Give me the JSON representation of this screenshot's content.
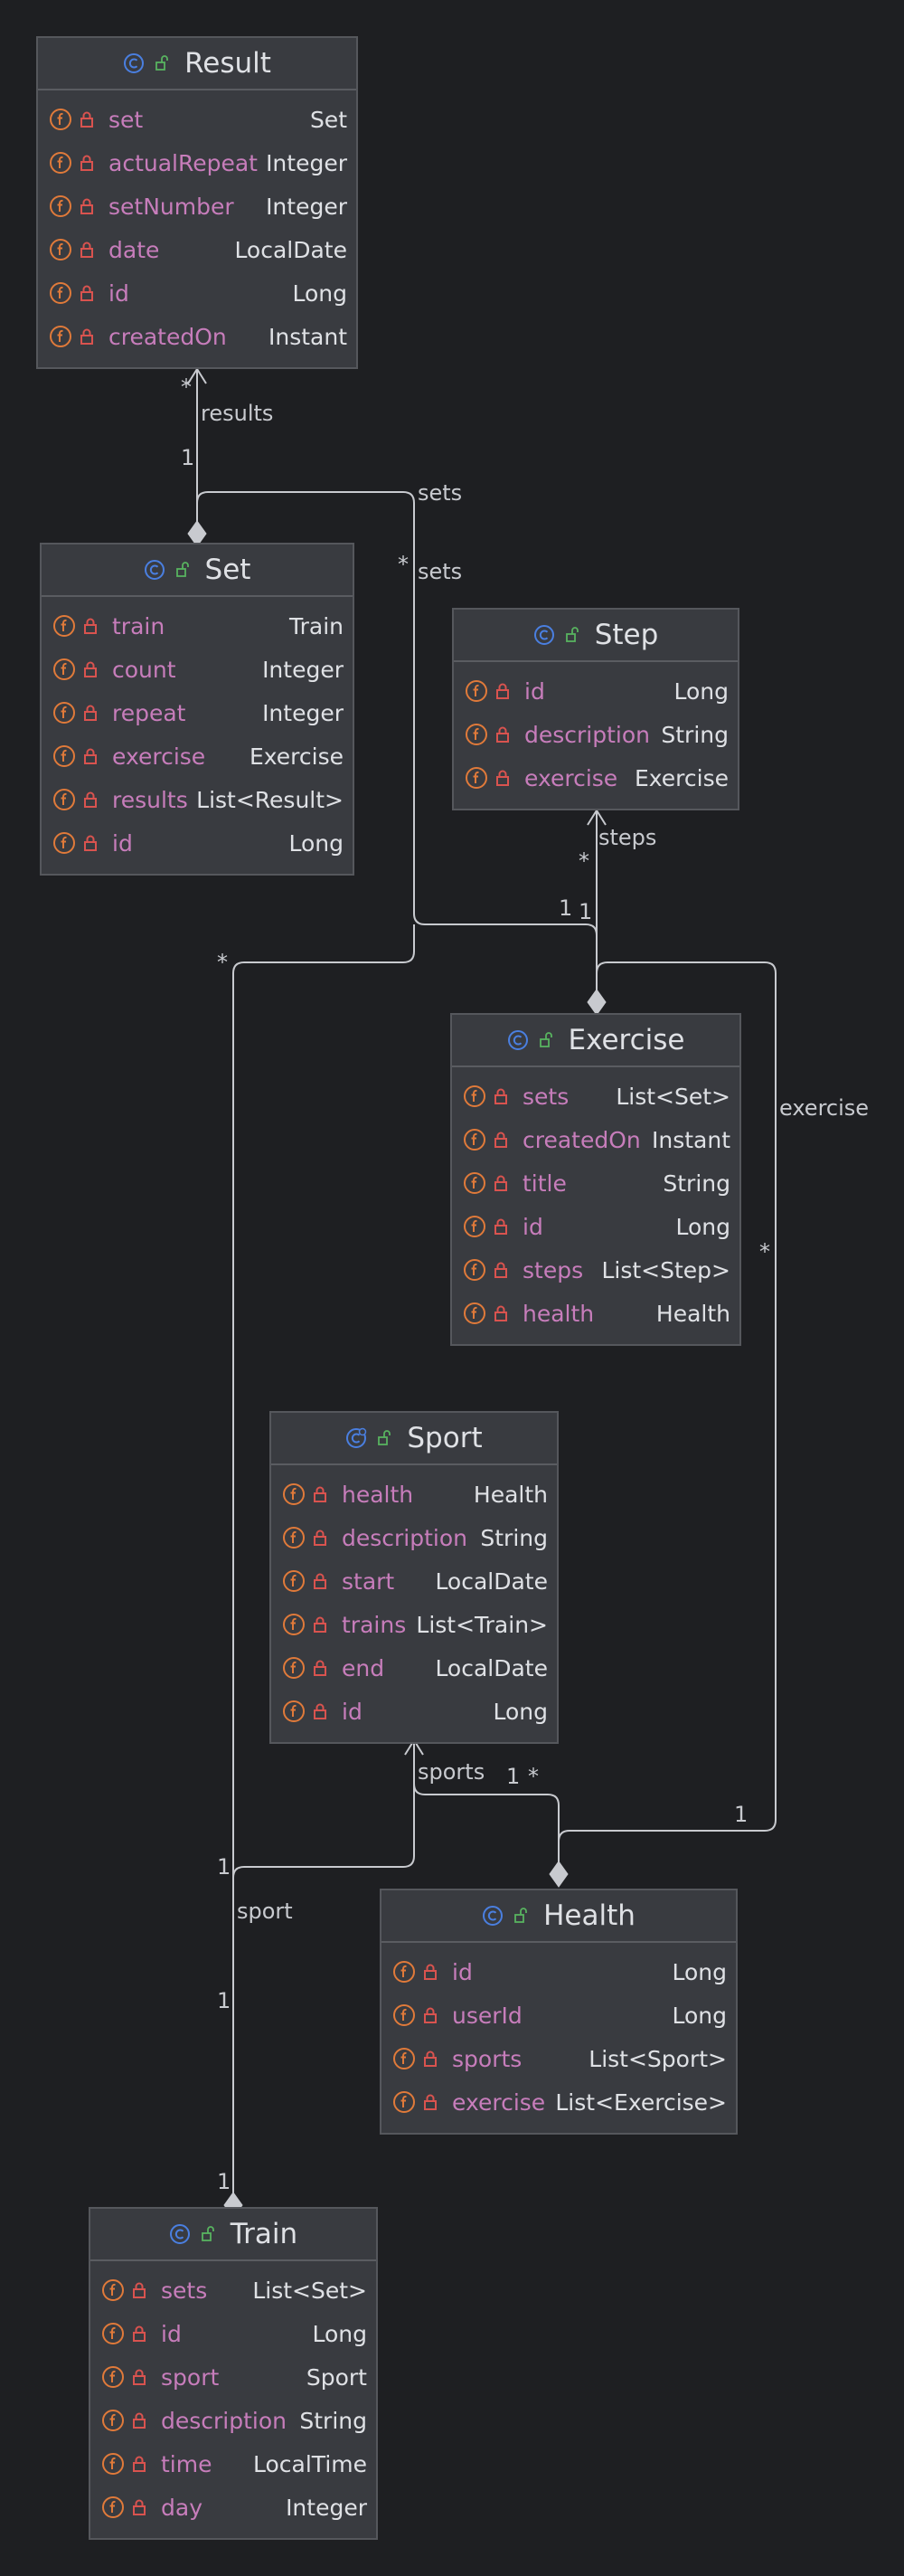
{
  "colors": {
    "background": "#1e1f22",
    "box_fill": "#393b40",
    "field_name": "#c77dbb",
    "text": "#dfe1e5",
    "class_icon": "#4a7fe0",
    "field_icon": "#e07a3a",
    "lock_icon": "#d9534f",
    "visibility_icon": "#58b35f",
    "edge": "#c8cacf"
  },
  "classes": [
    {
      "id": "result",
      "name": "Result",
      "kind": "class",
      "fields": [
        {
          "name": "set",
          "type": "Set"
        },
        {
          "name": "actualRepeat",
          "type": "Integer"
        },
        {
          "name": "setNumber",
          "type": "Integer"
        },
        {
          "name": "date",
          "type": "LocalDate"
        },
        {
          "name": "id",
          "type": "Long"
        },
        {
          "name": "createdOn",
          "type": "Instant"
        }
      ]
    },
    {
      "id": "set",
      "name": "Set",
      "kind": "class",
      "fields": [
        {
          "name": "train",
          "type": "Train"
        },
        {
          "name": "count",
          "type": "Integer"
        },
        {
          "name": "repeat",
          "type": "Integer"
        },
        {
          "name": "exercise",
          "type": "Exercise"
        },
        {
          "name": "results",
          "type": "List<Result>"
        },
        {
          "name": "id",
          "type": "Long"
        }
      ]
    },
    {
      "id": "step",
      "name": "Step",
      "kind": "class",
      "fields": [
        {
          "name": "id",
          "type": "Long"
        },
        {
          "name": "description",
          "type": "String"
        },
        {
          "name": "exercise",
          "type": "Exercise"
        }
      ]
    },
    {
      "id": "exercise",
      "name": "Exercise",
      "kind": "class",
      "fields": [
        {
          "name": "sets",
          "type": "List<Set>"
        },
        {
          "name": "createdOn",
          "type": "Instant"
        },
        {
          "name": "title",
          "type": "String"
        },
        {
          "name": "id",
          "type": "Long"
        },
        {
          "name": "steps",
          "type": "List<Step>"
        },
        {
          "name": "health",
          "type": "Health"
        }
      ]
    },
    {
      "id": "sport",
      "name": "Sport",
      "kind": "class-timed",
      "fields": [
        {
          "name": "health",
          "type": "Health"
        },
        {
          "name": "description",
          "type": "String"
        },
        {
          "name": "start",
          "type": "LocalDate"
        },
        {
          "name": "trains",
          "type": "List<Train>"
        },
        {
          "name": "end",
          "type": "LocalDate"
        },
        {
          "name": "id",
          "type": "Long"
        }
      ]
    },
    {
      "id": "health",
      "name": "Health",
      "kind": "class",
      "fields": [
        {
          "name": "id",
          "type": "Long"
        },
        {
          "name": "userId",
          "type": "Long"
        },
        {
          "name": "sports",
          "type": "List<Sport>"
        },
        {
          "name": "exercise",
          "type": "List<Exercise>"
        }
      ]
    },
    {
      "id": "train",
      "name": "Train",
      "kind": "class",
      "fields": [
        {
          "name": "sets",
          "type": "List<Set>"
        },
        {
          "name": "id",
          "type": "Long"
        },
        {
          "name": "sport",
          "type": "Sport"
        },
        {
          "name": "description",
          "type": "String"
        },
        {
          "name": "time",
          "type": "LocalTime"
        },
        {
          "name": "day",
          "type": "Integer"
        }
      ]
    }
  ],
  "edge_labels": {
    "results": "results",
    "sets_top": "sets",
    "sets_side": "sets",
    "steps": "steps",
    "exercise": "exercise",
    "sports": "sports",
    "sport": "sport"
  },
  "multiplicities": {
    "result_star": "*",
    "set_one": "1",
    "sets_star": "*",
    "set_star_left": "*",
    "step_star": "*",
    "exercise_one_a": "1",
    "exercise_one_b": "1",
    "exercise_star_right": "*",
    "sport_one": "1",
    "sport_star": "*",
    "health_one_right": "1",
    "train_one_a": "1",
    "train_one_b": "1",
    "train_one_c": "1"
  }
}
